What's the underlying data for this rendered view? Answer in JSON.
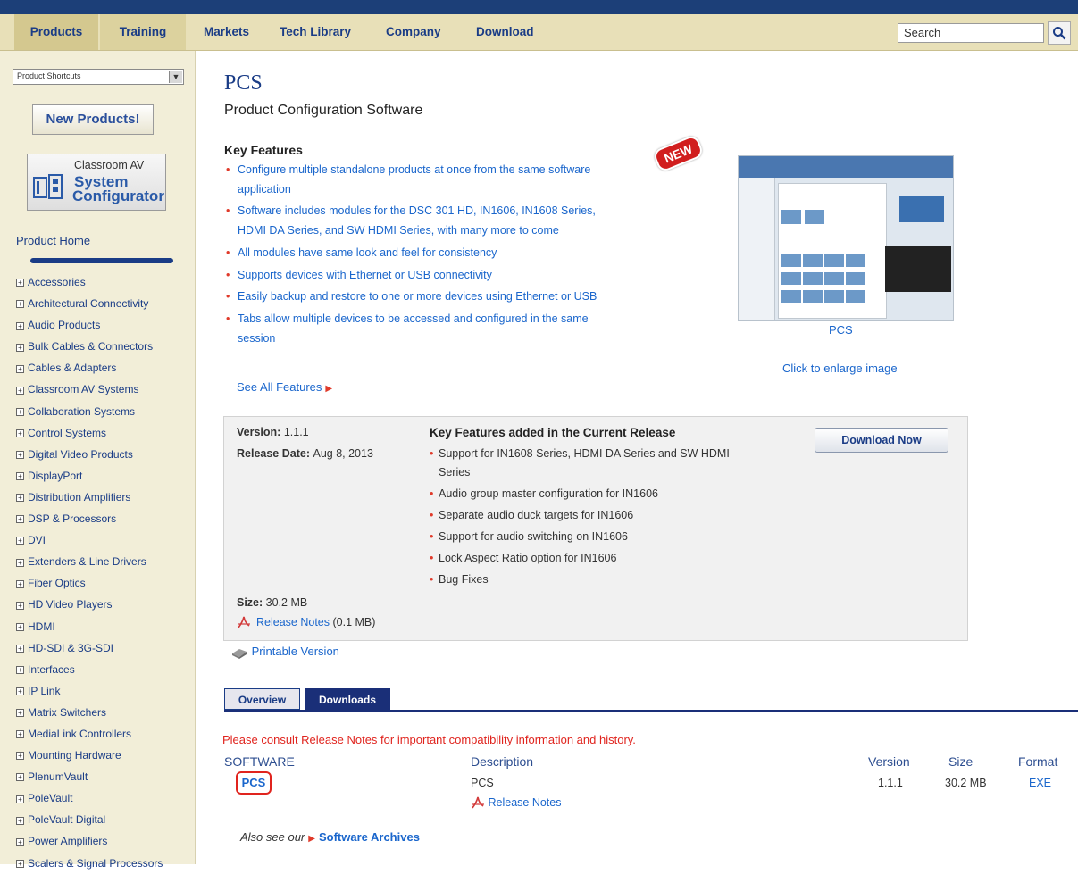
{
  "nav": {
    "items": [
      {
        "label": "Products"
      },
      {
        "label": "Training"
      },
      {
        "label": "Markets"
      },
      {
        "label": "Tech Library"
      },
      {
        "label": "Company"
      },
      {
        "label": "Download"
      }
    ],
    "search_value": "Search",
    "search_icon": "search-icon"
  },
  "sidebar": {
    "shortcuts_value": "Product Shortcuts",
    "new_products_label": "New Products!",
    "system_config": {
      "line1": "Classroom AV",
      "line2": "System",
      "line3": "Configurator"
    },
    "product_home": "Product Home",
    "categories": [
      "Accessories",
      "Architectural Connectivity",
      "Audio Products",
      "Bulk Cables & Connectors",
      "Cables & Adapters",
      "Classroom AV Systems",
      "Collaboration Systems",
      "Control Systems",
      "Digital Video Products",
      "DisplayPort",
      "Distribution Amplifiers",
      "DSP & Processors",
      "DVI",
      "Extenders & Line Drivers",
      "Fiber Optics",
      "HD Video Players",
      "HDMI",
      "HD-SDI & 3G-SDI",
      "Interfaces",
      "IP Link",
      "Matrix Switchers",
      "MediaLink Controllers",
      "Mounting Hardware",
      "PlenumVault",
      "PoleVault",
      "PoleVault Digital",
      "Power Amplifiers",
      "Scalers & Signal Processors"
    ]
  },
  "product": {
    "title": "PCS",
    "subtitle": "Product Configuration Software",
    "badge": "NEW",
    "key_features_heading": "Key Features",
    "features": [
      "Configure multiple standalone products at once from the same software application",
      "Software includes modules for the DSC 301 HD, IN1606, IN1608 Series, HDMI DA Series, and SW HDMI Series, with many more to come",
      "All modules have same look and feel for consistency",
      "Supports devices with Ethernet or USB connectivity",
      "Easily backup and restore to one or more devices using Ethernet or USB",
      "Tabs allow multiple devices to be accessed and configured in the same session"
    ],
    "see_all": "See All Features",
    "image_caption": "PCS",
    "enlarge": "Click to enlarge image"
  },
  "release": {
    "version_label": "Version:",
    "version": "1.1.1",
    "date_label": "Release Date:",
    "date": "Aug 8, 2013",
    "current_heading": "Key Features added in the Current Release",
    "items": [
      "Support for IN1608 Series, HDMI DA Series and SW HDMI Series",
      "Audio group master configuration for IN1606",
      "Separate audio duck targets for IN1606",
      "Support for audio switching on IN1606",
      "Lock Aspect Ratio option for IN1606",
      "Bug Fixes"
    ],
    "download_label": "Download Now",
    "size_label": "Size:",
    "size": "30.2 MB",
    "notes_link": "Release Notes",
    "notes_size": "(0.1 MB)",
    "printable": "Printable Version"
  },
  "tabs": {
    "overview": "Overview",
    "downloads": "Downloads"
  },
  "downloads": {
    "consult": "Please consult Release Notes for important compatibility information and history.",
    "headers": {
      "software": "SOFTWARE",
      "description": "Description",
      "version": "Version",
      "size": "Size",
      "format": "Format"
    },
    "row": {
      "name": "PCS",
      "description": "PCS",
      "notes": "Release Notes",
      "version": "1.1.1",
      "size": "30.2 MB",
      "format": "EXE"
    },
    "also_see": "Also see our",
    "archives": "Software Archives"
  },
  "colors": {
    "brand_blue": "#1a3c86",
    "link_blue": "#1a66cc",
    "accent_red": "#e0241e",
    "nav_bg": "#e8e0b8"
  }
}
